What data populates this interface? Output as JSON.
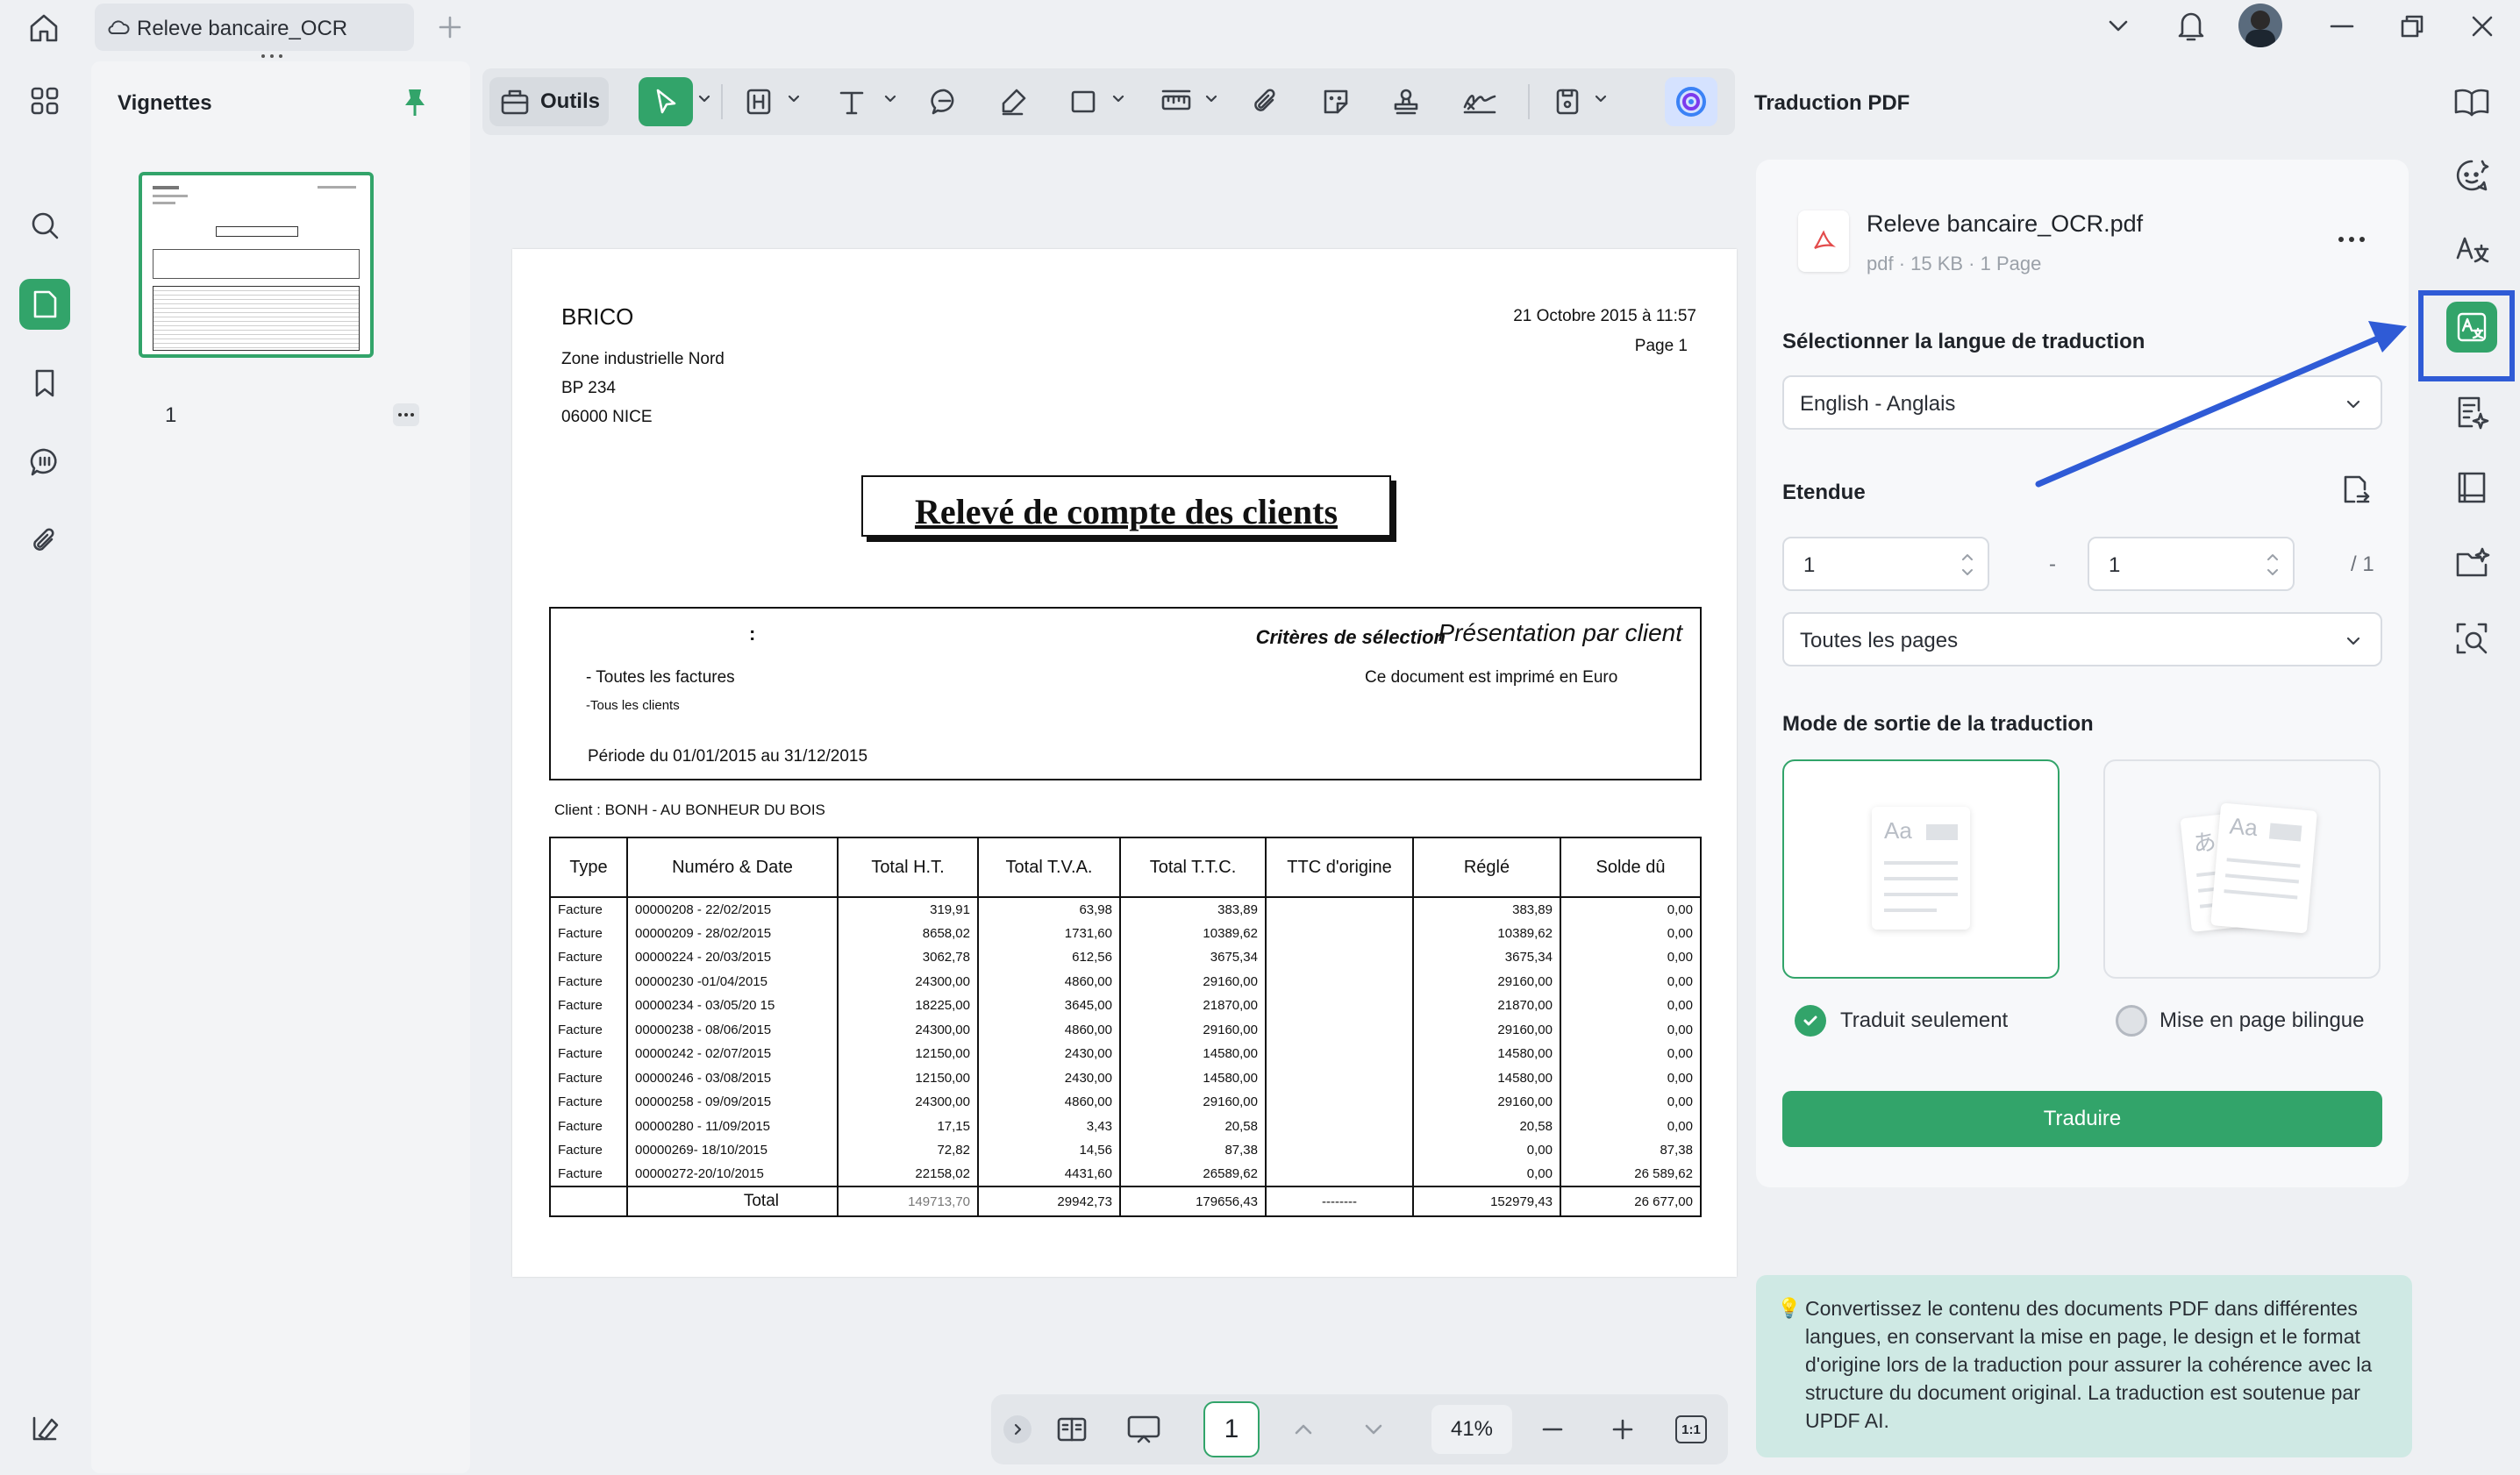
{
  "window": {
    "tab_title": "Releve bancaire_OCR"
  },
  "thumbnails": {
    "title": "Vignettes",
    "page_number": "1"
  },
  "toolbar": {
    "tools_label": "Outils"
  },
  "document": {
    "company": "BRICO",
    "address": [
      "Zone industrielle Nord",
      "BP 234",
      "06000 NICE"
    ],
    "date": "21 Octobre 2015 à 11:57",
    "page": "Page 1",
    "title": "Relevé de compte des clients",
    "colon": ":",
    "criteria_label": "Critères de sélection",
    "criteria_value": "Présentation par client",
    "all_invoices": "- Toutes les factures",
    "all_clients": "-Tous les clients",
    "currency_note": "Ce document est imprimé en Euro",
    "period": "Période du 01/01/2015 au 31/12/2015",
    "client": "Client : BONH - AU BONHEUR DU BOIS",
    "columns": [
      "Type",
      "Numéro & Date",
      "Total H.T.",
      "Total T.V.A.",
      "Total T.T.C.",
      "TTC d'origine",
      "Réglé",
      "Solde dû"
    ],
    "rows": [
      [
        "Facture",
        "00000208 - 22/02/2015",
        "319,91",
        "63,98",
        "383,89",
        "",
        "383,89",
        "0,00"
      ],
      [
        "Facture",
        "00000209 - 28/02/2015",
        "8658,02",
        "1731,60",
        "10389,62",
        "",
        "10389,62",
        "0,00"
      ],
      [
        "Facture",
        "00000224 - 20/03/2015",
        "3062,78",
        "612,56",
        "3675,34",
        "",
        "3675,34",
        "0,00"
      ],
      [
        "Facture",
        "00000230 -01/04/2015",
        "24300,00",
        "4860,00",
        "29160,00",
        "",
        "29160,00",
        "0,00"
      ],
      [
        "Facture",
        "00000234 - 03/05/20 15",
        "18225,00",
        "3645,00",
        "21870,00",
        "",
        "21870,00",
        "0,00"
      ],
      [
        "Facture",
        "00000238 - 08/06/2015",
        "24300,00",
        "4860,00",
        "29160,00",
        "",
        "29160,00",
        "0,00"
      ],
      [
        "Facture",
        "00000242 - 02/07/2015",
        "12150,00",
        "2430,00",
        "14580,00",
        "",
        "14580,00",
        "0,00"
      ],
      [
        "Facture",
        "00000246 - 03/08/2015",
        "12150,00",
        "2430,00",
        "14580,00",
        "",
        "14580,00",
        "0,00"
      ],
      [
        "Facture",
        "00000258 - 09/09/2015",
        "24300,00",
        "4860,00",
        "29160,00",
        "",
        "29160,00",
        "0,00"
      ],
      [
        "Facture",
        "00000280 - 11/09/2015",
        "17,15",
        "3,43",
        "20,58",
        "",
        "20,58",
        "0,00"
      ],
      [
        "Facture",
        "00000269- 18/10/2015",
        "72,82",
        "14,56",
        "87,38",
        "",
        "0,00",
        "87,38"
      ],
      [
        "Facture",
        "00000272-20/10/2015",
        "22158,02",
        "4431,60",
        "26589,62",
        "",
        "0,00",
        "26 589,62"
      ]
    ],
    "total_row": [
      "",
      "Total",
      "149713,70",
      "29942,73",
      "179656,43",
      "--------",
      "152979,43",
      "26 677,00"
    ]
  },
  "bottombar": {
    "page_input": "1",
    "zoom": "41%",
    "fit_label": "1:1"
  },
  "translate_panel": {
    "title": "Traduction PDF",
    "file_name": "Releve bancaire_OCR.pdf",
    "file_meta": "pdf · 15 KB · 1 Page",
    "lang_label": "Sélectionner la langue de traduction",
    "lang_value": "English - Anglais",
    "range_label": "Etendue",
    "range_from": "1",
    "range_dash": "-",
    "range_to": "1",
    "range_total": "/ 1",
    "pages_value": "Toutes les pages",
    "mode_label": "Mode de sortie de la traduction",
    "mode_translated": "Traduit seulement",
    "mode_bilingual": "Mise en page bilingue",
    "card_sample_aa": "Aa",
    "card_sample_a": "あ",
    "translate_button": "Traduire",
    "tip": "Convertissez le contenu des documents PDF dans différentes langues, en conservant la mise en page, le design et le format d'origine lors de la traduction pour assurer la cohérence avec la structure du document original. La traduction est soutenue par UPDF AI."
  },
  "colors": {
    "accent_green": "#32a46a",
    "highlight_blue": "#2f5bd6",
    "tip_bg": "#cfe9e4"
  }
}
